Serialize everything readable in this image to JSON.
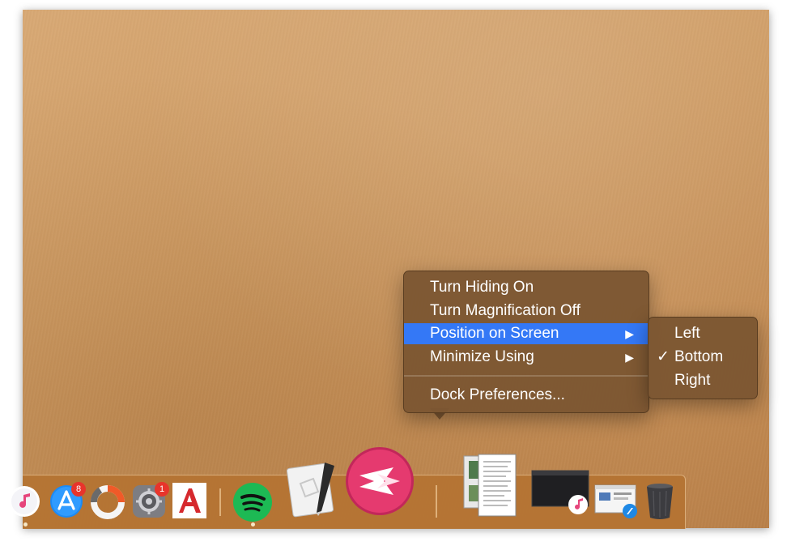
{
  "context_menu": {
    "items": [
      {
        "label": "Turn Hiding On"
      },
      {
        "label": "Turn Magnification Off"
      },
      {
        "label": "Position on Screen",
        "selected": true,
        "submenu": true
      },
      {
        "label": "Minimize Using",
        "submenu": true
      },
      {
        "label": "Dock Preferences..."
      }
    ],
    "submenu_arrow": "▶"
  },
  "position_submenu": {
    "items": [
      {
        "label": "Left"
      },
      {
        "label": "Bottom",
        "checked": true
      },
      {
        "label": "Right"
      }
    ],
    "check_mark": "✓"
  },
  "dock": {
    "apps": [
      {
        "name": "iTunes",
        "icon": "music-note-icon",
        "running": true
      },
      {
        "name": "App Store",
        "icon": "app-store-icon",
        "badge": "8"
      },
      {
        "name": "Creative Cloud",
        "icon": "ring-icon"
      },
      {
        "name": "System Preferences",
        "icon": "gear-icon",
        "badge": "1"
      },
      {
        "name": "AutoCAD",
        "icon": "autocad-icon"
      },
      {
        "name": "Spotify",
        "icon": "spotify-icon",
        "running": true
      },
      {
        "name": "Script Editor",
        "icon": "script-editor-icon"
      },
      {
        "name": "Skitch",
        "icon": "skitch-icon"
      }
    ],
    "minimized": [
      {
        "name": "Document window",
        "icon": "document-thumbnail-icon"
      },
      {
        "name": "iTunes window",
        "icon": "itunes-thumbnail-icon"
      },
      {
        "name": "Safari window",
        "icon": "safari-thumbnail-icon"
      }
    ],
    "trash": {
      "name": "Trash",
      "icon": "trash-icon"
    }
  },
  "colors": {
    "selection": "#3478f6",
    "menu_background": "#7c5632",
    "dock_background": "#b47332",
    "badge": "#e8342b"
  }
}
